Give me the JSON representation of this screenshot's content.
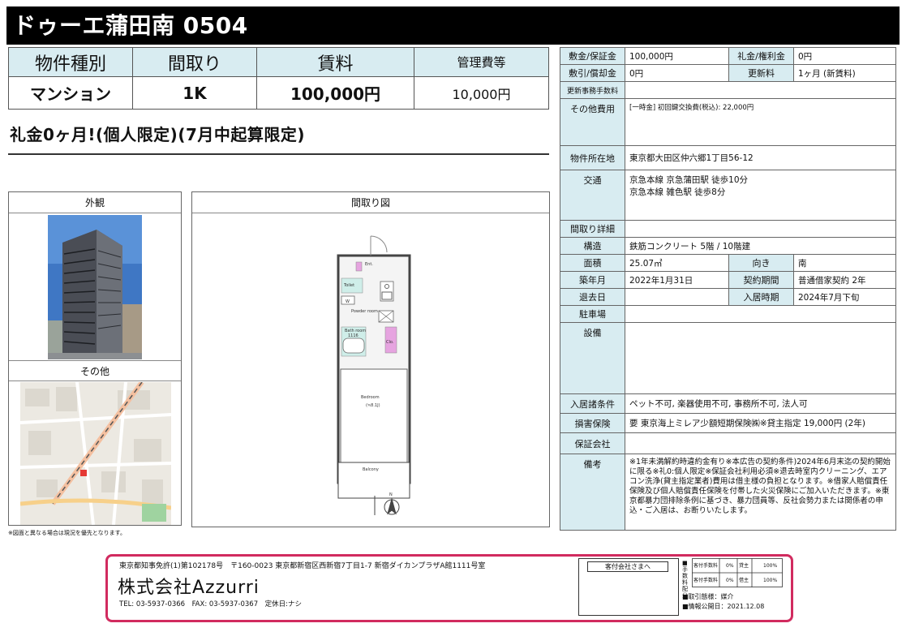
{
  "title": "ドゥーエ蒲田南 0504",
  "summary": {
    "headers": [
      "物件種別",
      "間取り",
      "賃料",
      "管理費等"
    ],
    "values": [
      "マンション",
      "1K",
      "100,000円",
      "10,000円"
    ]
  },
  "headline": "礼金0ヶ月!(個人限定)(7月中起算限定)",
  "panels": {
    "exterior_label": "外観",
    "other_label": "その他",
    "floorplan_label": "間取り図",
    "photo_note": "※図面と異なる場合は現況を優先となります。"
  },
  "floorplan": {
    "ent": "Ent.",
    "toilet": "Toilet",
    "powder_room": "Powder room",
    "bath_room": "Bath room",
    "bath_size": "1116",
    "closet": "Clo.",
    "bedroom": "Bedroom",
    "bedroom_size": "(≒8.1J)",
    "balcony": "Balcony",
    "washer": "W",
    "north": "N"
  },
  "details": {
    "deposit_label": "敷金/保証金",
    "deposit": "100,000円",
    "key_money_label": "礼金/権利金",
    "key_money": "0円",
    "amort_label": "敷引/償却金",
    "amort": "0円",
    "renewal_label": "更新料",
    "renewal": "1ヶ月 (新賃料)",
    "renewal_admin_label": "更新事務手数料",
    "renewal_admin": "",
    "other_fees_label": "その他費用",
    "other_fees": "[一時金] 初回鍵交換費(税込): 22,000円",
    "address_label": "物件所在地",
    "address": "東京都大田区仲六郷1丁目56-12",
    "transport_label": "交通",
    "transport_1": "京急本線 京急蒲田駅 徒歩10分",
    "transport_2": "京急本線 雑色駅 徒歩8分",
    "layout_detail_label": "間取り詳細",
    "layout_detail": "",
    "structure_label": "構造",
    "structure": "鉄筋コンクリート 5階 / 10階建",
    "area_label": "面積",
    "area": "25.07㎡",
    "direction_label": "向き",
    "direction": "南",
    "built_label": "築年月",
    "built": "2022年1月31日",
    "contract_label": "契約期間",
    "contract": "普通借家契約 2年",
    "vacate_label": "退去日",
    "vacate": "",
    "movein_label": "入居時期",
    "movein": "2024年7月下旬",
    "parking_label": "駐車場",
    "parking": "",
    "facilities_label": "設備",
    "facilities": "",
    "conditions_label": "入居諸条件",
    "conditions": "ペット不可, 楽器使用不可, 事務所不可, 法人可",
    "insurance_label": "損害保険",
    "insurance": "要 東京海上ミレア少額短期保険㈱※貸主指定 19,000円 (2年)",
    "guarantor_label": "保証会社",
    "guarantor": "",
    "remarks_label": "備考",
    "remarks": "※1年未満解約時違約金有り※本広告の契約条件)2024年6月末迄の契約開始に限る※礼0:個人限定※保証会社利用必須※退去時室内クリーニング、エアコン洗浄(貸主指定業者)費用は借主様の負担となります。※借家人賠償責任保険及び個人賠償責任保険を付帯した火災保険にご加入いただきます。※東京都暴力団排除条例に基づき、暴力団員等、反社会勢力または関係者の申込・ご入居は、お断りいたします。"
  },
  "footer": {
    "address": "東京都知事免許(1)第102178号　〒160-0023 東京都新宿区西新宿7丁目1-7 新宿ダイカンプラザA館1111号室",
    "company": "株式会社Azzurri",
    "contact": "TEL: 03-5937-0366　FAX: 03-5937-0367　定休日:ナシ",
    "stamp_label": "客付会社さまへ",
    "ref_lines": [
      "■取引態様：媒介",
      "■情報公開日：2021.12.08"
    ],
    "fee_cells": [
      "客付手数料",
      "0%",
      "貸主",
      "100%",
      "客付手数料",
      "0%",
      "借主",
      "100%"
    ],
    "fee_side": "■手数料配分"
  },
  "colors": {
    "header_bg": "#d8ecf1",
    "title_bg": "#000000",
    "footer_border": "#d12b5f",
    "toilet_accent": "#e6a4e0"
  }
}
